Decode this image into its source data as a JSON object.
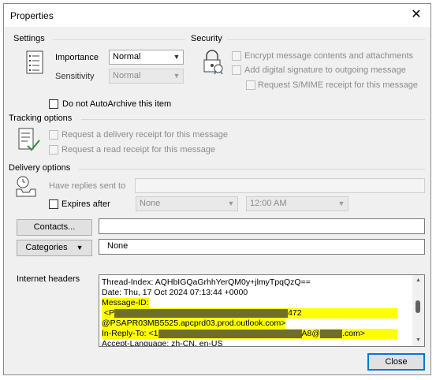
{
  "window": {
    "title": "Properties"
  },
  "settings": {
    "heading": "Settings",
    "importance_label": "Importance",
    "importance_value": "Normal",
    "sensitivity_label": "Sensitivity",
    "sensitivity_value": "Normal",
    "autoarchive_label": "Do not AutoArchive this item",
    "autoarchive_checked": false
  },
  "security": {
    "heading": "Security",
    "encrypt_label": "Encrypt message contents and attachments",
    "signature_label": "Add digital signature to outgoing message",
    "smime_label": "Request S/MIME receipt for this message"
  },
  "tracking": {
    "heading": "Tracking options",
    "delivery_receipt_label": "Request a delivery receipt for this message",
    "read_receipt_label": "Request a read receipt for this message"
  },
  "delivery": {
    "heading": "Delivery options",
    "replies_label": "Have replies sent to",
    "replies_value": "",
    "expires_label": "Expires after",
    "expires_date": "None",
    "expires_time": "12:00 AM"
  },
  "contacts_button": "Contacts...",
  "contacts_value": "",
  "categories_button": "Categories",
  "categories_value": "None",
  "internet_headers": {
    "label": "Internet headers",
    "lines": [
      "Thread-Index: AQHbIGQaGrhhYerQM0y+jlmyTpqQzQ==",
      "Date: Thu, 17 Oct 2024 07:13:44 +0000",
      "Message-ID:",
      "472",
      "@PSAPR03MB5525.apcprd03.prod.outlook.com>",
      "In-Reply-To:",
      "A8@",
      ".com>",
      "Accept-Language: zh-CN, en-US"
    ],
    "line3_prefix": "<P",
    "line6_prefix": "<1",
    "highlight_color": "#ffff00"
  },
  "close_button": "Close"
}
